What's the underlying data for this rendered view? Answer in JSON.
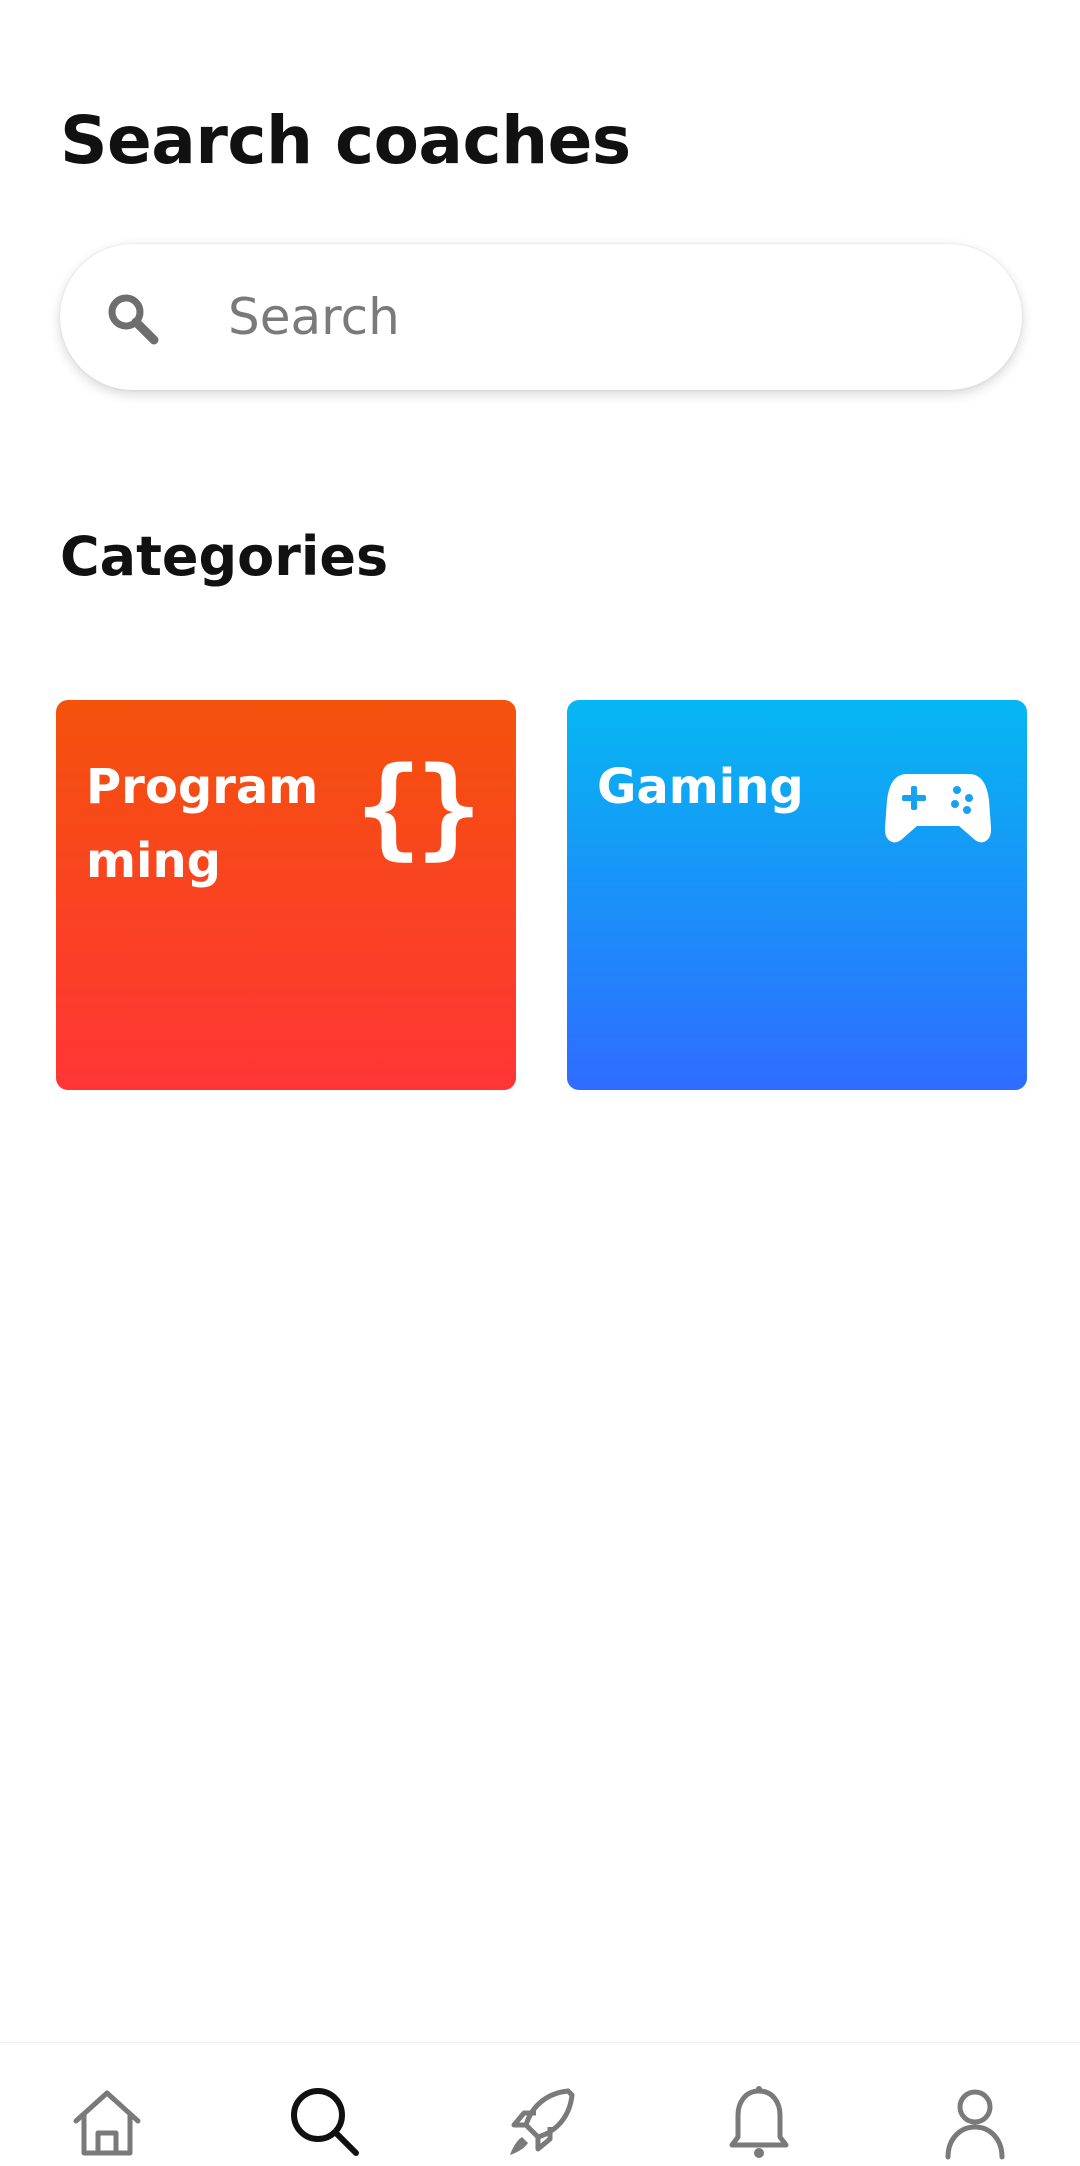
{
  "header": {
    "title": "Search coaches"
  },
  "search": {
    "placeholder": "Search",
    "value": "",
    "icon": "search-icon"
  },
  "categories_section": {
    "title": "Categories",
    "items": [
      {
        "label": "Programming",
        "icon": "code-braces-icon",
        "icon_glyph": "{}",
        "gradient_top": "#f4520c",
        "gradient_bottom": "#ff3535"
      },
      {
        "label": "Gaming",
        "icon": "gamepad-icon",
        "gradient_top": "#05b7f2",
        "gradient_bottom": "#2f6cff"
      }
    ]
  },
  "bottom_nav": {
    "items": [
      {
        "icon": "home-icon",
        "active": false
      },
      {
        "icon": "search-icon",
        "active": true
      },
      {
        "icon": "rocket-icon",
        "active": false
      },
      {
        "icon": "bell-icon",
        "active": false
      },
      {
        "icon": "profile-icon",
        "active": false
      }
    ],
    "active_color": "#111111",
    "inactive_color": "#7a7a7a"
  }
}
